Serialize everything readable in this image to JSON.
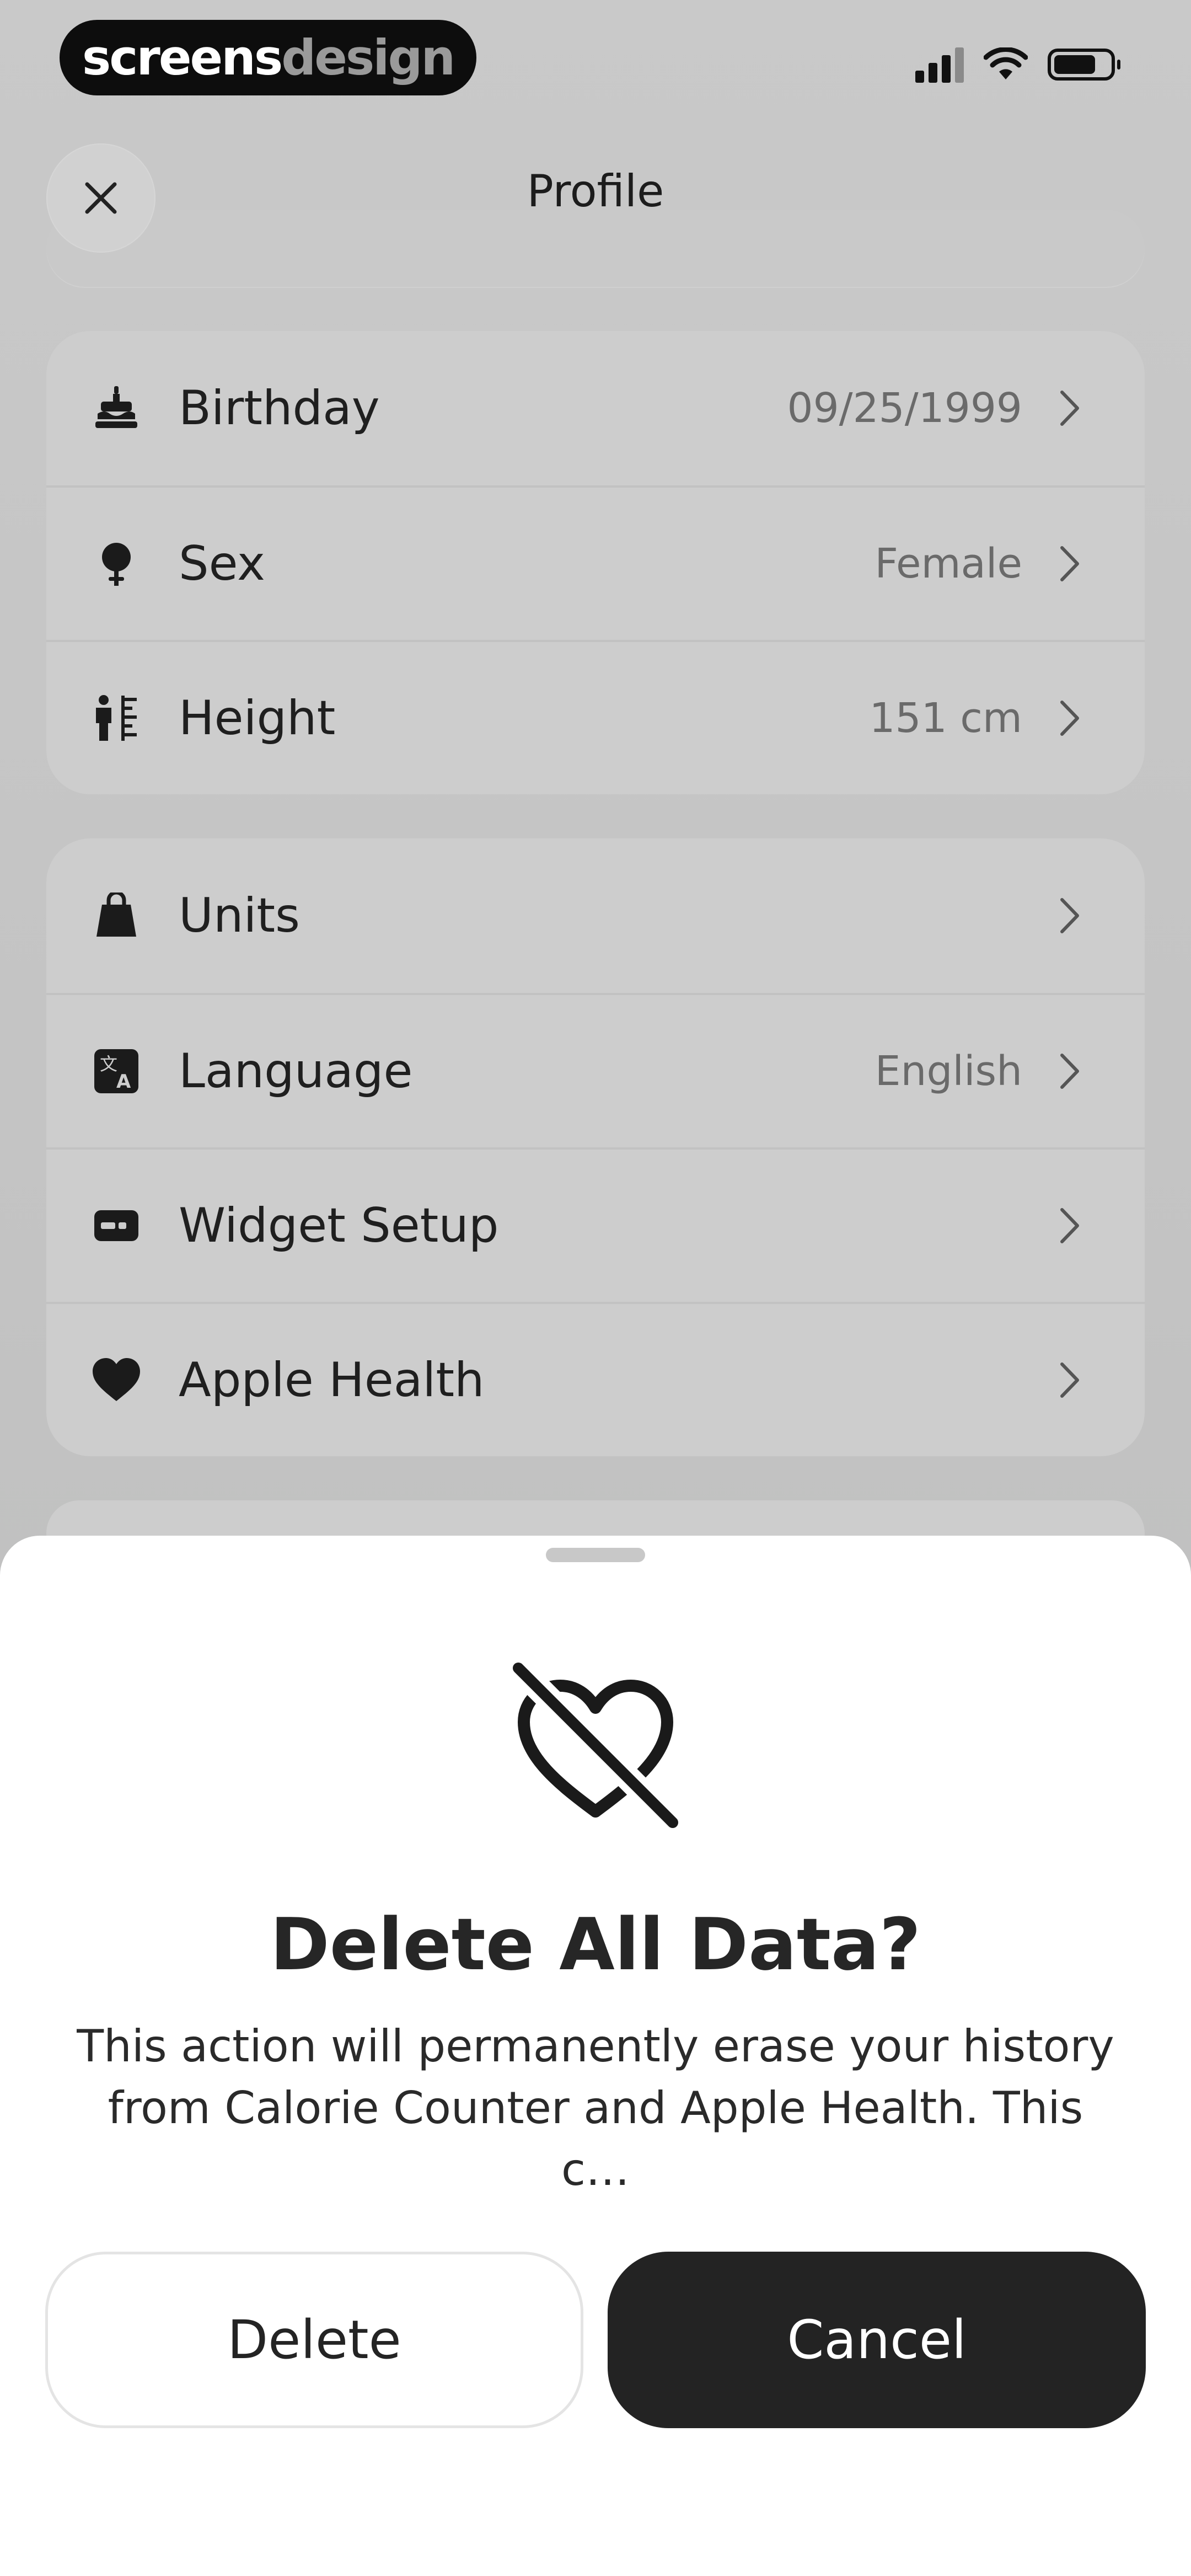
{
  "status": {
    "brand_part1": "screens",
    "brand_part2": "design"
  },
  "header": {
    "title": "Profile",
    "close_icon": "close-icon"
  },
  "profile_card": {
    "rows": [
      {
        "label": "Birthday",
        "value": "09/25/1999",
        "icon": "cake-icon"
      },
      {
        "label": "Sex",
        "value": "Female",
        "icon": "female-icon"
      },
      {
        "label": "Height",
        "value": "151 cm",
        "icon": "height-icon"
      }
    ]
  },
  "settings_card": {
    "rows": [
      {
        "label": "Units",
        "value": "",
        "icon": "weight-icon"
      },
      {
        "label": "Language",
        "value": "English",
        "icon": "translate-icon"
      },
      {
        "label": "Widget Setup",
        "value": "",
        "icon": "widget-icon"
      },
      {
        "label": "Apple Health",
        "value": "",
        "icon": "heart-icon"
      }
    ]
  },
  "sheet": {
    "icon": "heart-off-icon",
    "title": "Delete All Data?",
    "message": "This action will permanently erase your history from Calorie Counter and Apple Health. This c…",
    "delete_label": "Delete",
    "cancel_label": "Cancel"
  },
  "colors": {
    "cancel_bg": "#232323",
    "sheet_bg": "#ffffff"
  }
}
